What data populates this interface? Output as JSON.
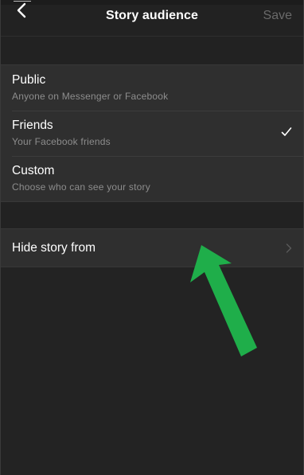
{
  "header": {
    "title": "Story audience",
    "save_label": "Save",
    "back_icon": "chevron-left-icon"
  },
  "audience_options": [
    {
      "label": "Public",
      "description": "Anyone on Messenger or Facebook",
      "selected": false
    },
    {
      "label": "Friends",
      "description": "Your Facebook friends",
      "selected": true
    },
    {
      "label": "Custom",
      "description": "Choose who can see your story",
      "selected": false
    }
  ],
  "hide_story": {
    "label": "Hide story from",
    "icon": "chevron-right-icon"
  },
  "annotation": {
    "icon": "green-arrow-icon",
    "color": "#1fae4a"
  },
  "colors": {
    "background": "#232323",
    "row": "#2f2f2f",
    "text": "#ffffff",
    "subtext": "#8d8d8d",
    "disabled": "#6a6a6a"
  }
}
